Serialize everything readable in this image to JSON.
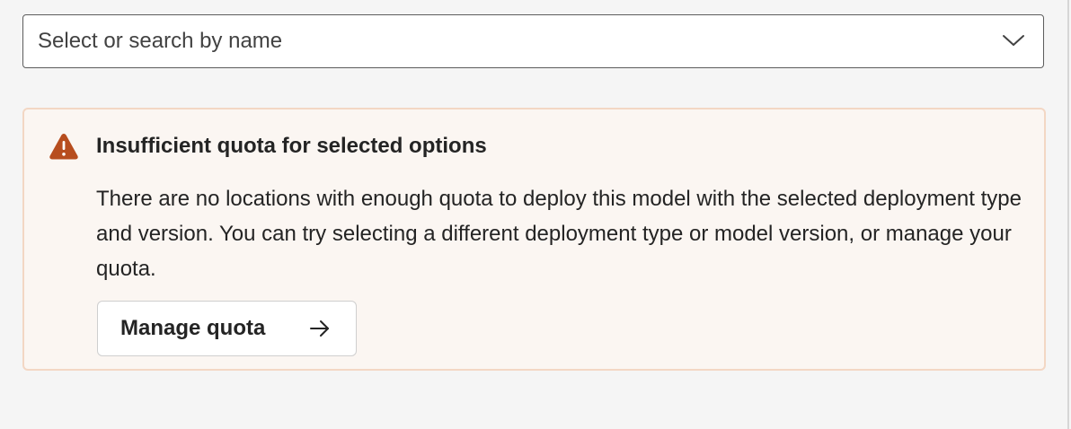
{
  "model_select": {
    "placeholder": "Select or search by name",
    "value": "",
    "chevron_icon": "chevron-down-icon"
  },
  "alert": {
    "severity": "warning",
    "icon": "warning-triangle-icon",
    "icon_color": "#b74d1e",
    "background_color": "#fbf6f2",
    "border_color": "#f3d7c4",
    "title": "Insufficient quota for selected options",
    "message": "There are no locations with enough quota to deploy this model with the selected deployment type and version. You can try selecting a different deployment type or model version, or manage your quota.",
    "action": {
      "label": "Manage quota",
      "icon": "arrow-right-icon"
    }
  }
}
